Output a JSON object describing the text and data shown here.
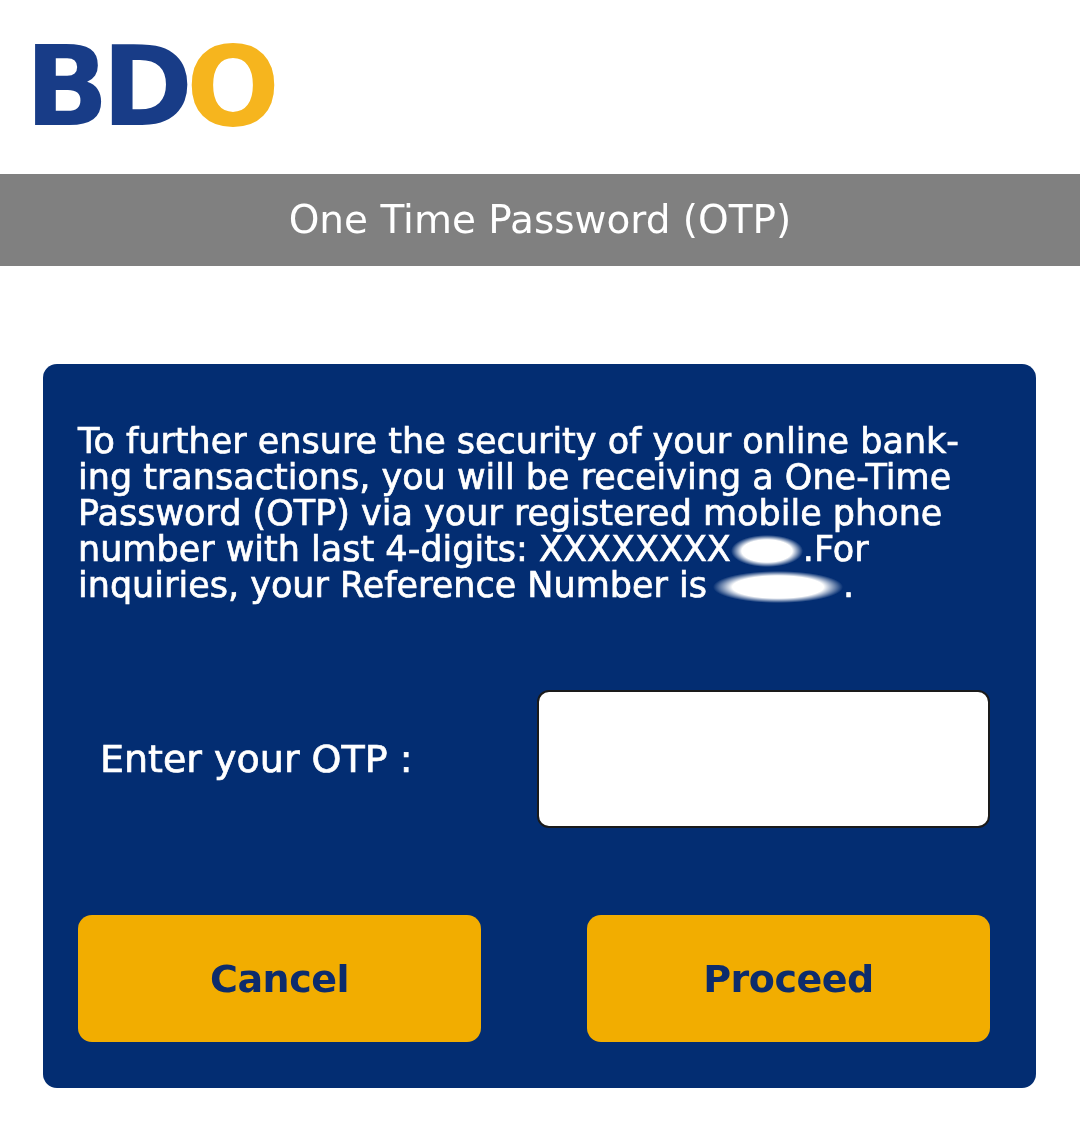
{
  "logo": {
    "parts": [
      {
        "text": "BD",
        "color": "#183c87"
      },
      {
        "text": "O",
        "color": "#f6b51e"
      }
    ]
  },
  "title_bar": {
    "title": "One Time Password (OTP)"
  },
  "otp_card": {
    "message": [
      {
        "kind": "text",
        "text": "To further ensure the security of your online bank-ing transactions, you will be receiving a One-Time Password (OTP) via your registered mobile phone number with last 4-digits: XXXXXXXX"
      },
      {
        "kind": "redacted"
      },
      {
        "kind": "text",
        "text": ".For inquiries, your Reference Number is"
      },
      {
        "kind": "redacted"
      },
      {
        "kind": "text",
        "text": "."
      }
    ],
    "otp_label": "Enter your OTP :",
    "buttons": [
      {
        "label": "Cancel"
      },
      {
        "label": "Proceed"
      }
    ]
  }
}
